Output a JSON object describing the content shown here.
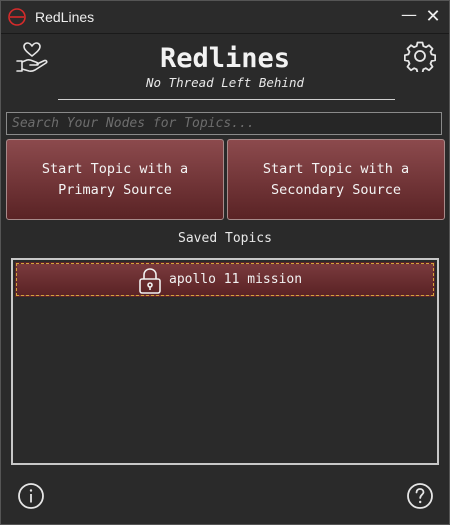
{
  "window": {
    "title": "RedLines",
    "minimize_glyph": "—",
    "close_glyph": "✕",
    "app_icon": "redlines-logo-icon"
  },
  "header": {
    "app_name": "Redlines",
    "tagline": "No Thread Left Behind",
    "left_icon": "heart-hand-icon",
    "right_icon": "gear-icon"
  },
  "search": {
    "placeholder": "Search Your Nodes for Topics...",
    "value": ""
  },
  "actions": {
    "primary_label": "Start Topic with a\nPrimary Source",
    "secondary_label": "Start Topic with a\nSecondary Source"
  },
  "saved": {
    "heading": "Saved Topics",
    "items": [
      {
        "label": "apollo 11 mission",
        "icon": "lock-icon"
      }
    ]
  },
  "footer": {
    "left_icon": "info-icon",
    "right_icon": "help-icon"
  },
  "colors": {
    "accent": "#7a3a3d",
    "accent_dark": "#5a2325",
    "background": "#2a2a2a",
    "selection_border": "#d4a33a"
  }
}
